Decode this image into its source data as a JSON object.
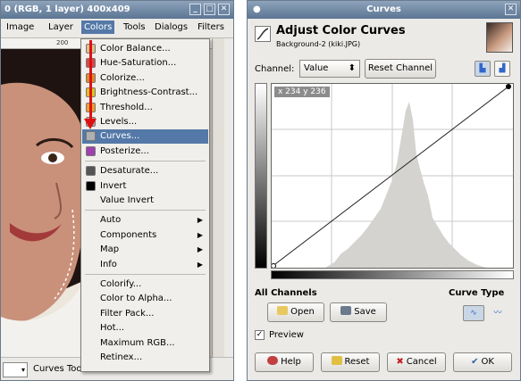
{
  "image_window": {
    "title": "0 (RGB, 1 layer) 400x409",
    "menubar": [
      "Image",
      "Layer",
      "Colors",
      "Tools",
      "Dialogs",
      "Filters"
    ],
    "active_menu": "Colors",
    "ruler_mark": "200",
    "status_unit": "▾",
    "status_text": "Curves Too"
  },
  "colors_menu": {
    "items": [
      {
        "label": "Color Balance...",
        "icon_color": "#d9c48a"
      },
      {
        "label": "Hue-Saturation...",
        "icon_color": "#d24c4c"
      },
      {
        "label": "Colorize...",
        "icon_color": "#e08a2a"
      },
      {
        "label": "Brightness-Contrast...",
        "icon_color": "#e0c020"
      },
      {
        "label": "Threshold...",
        "icon_color": "#f0a030"
      },
      {
        "label": "Levels...",
        "icon_color": "#b0b0b0"
      },
      {
        "label": "Curves...",
        "icon_color": "#b0b0b0"
      },
      {
        "label": "Posterize...",
        "icon_color": "#a040b0"
      },
      {
        "label": "Desaturate...",
        "icon_color": "#555555"
      },
      {
        "label": "Invert",
        "icon_color": "#000000"
      },
      {
        "label": "Value Invert",
        "icon_color": ""
      },
      {
        "label": "Auto",
        "icon_color": ""
      },
      {
        "label": "Components",
        "icon_color": ""
      },
      {
        "label": "Map",
        "icon_color": ""
      },
      {
        "label": "Info",
        "icon_color": ""
      },
      {
        "label": "Colorify...",
        "icon_color": ""
      },
      {
        "label": "Color to Alpha...",
        "icon_color": ""
      },
      {
        "label": "Filter Pack...",
        "icon_color": ""
      },
      {
        "label": "Hot...",
        "icon_color": ""
      },
      {
        "label": "Maximum RGB...",
        "icon_color": ""
      },
      {
        "label": "Retinex...",
        "icon_color": ""
      }
    ],
    "selected": "Curves...",
    "submenus": [
      "Auto",
      "Components",
      "Map",
      "Info"
    ]
  },
  "curves_dialog": {
    "window_title": "Curves",
    "title": "Adjust Color Curves",
    "subtitle": "Background-2 (kiki.JPG)",
    "channel_label": "Channel:",
    "channel_value": "Value",
    "reset_channel": "Reset Channel",
    "coord_readout": "x 234 y 236",
    "all_channels": "All Channels",
    "curve_type_label": "Curve Type",
    "open_label": "Open",
    "save_label": "Save",
    "preview_label": "Preview",
    "preview_checked": "✓",
    "help_label": "Help",
    "reset_label": "Reset",
    "cancel_label": "Cancel",
    "ok_label": "OK"
  }
}
